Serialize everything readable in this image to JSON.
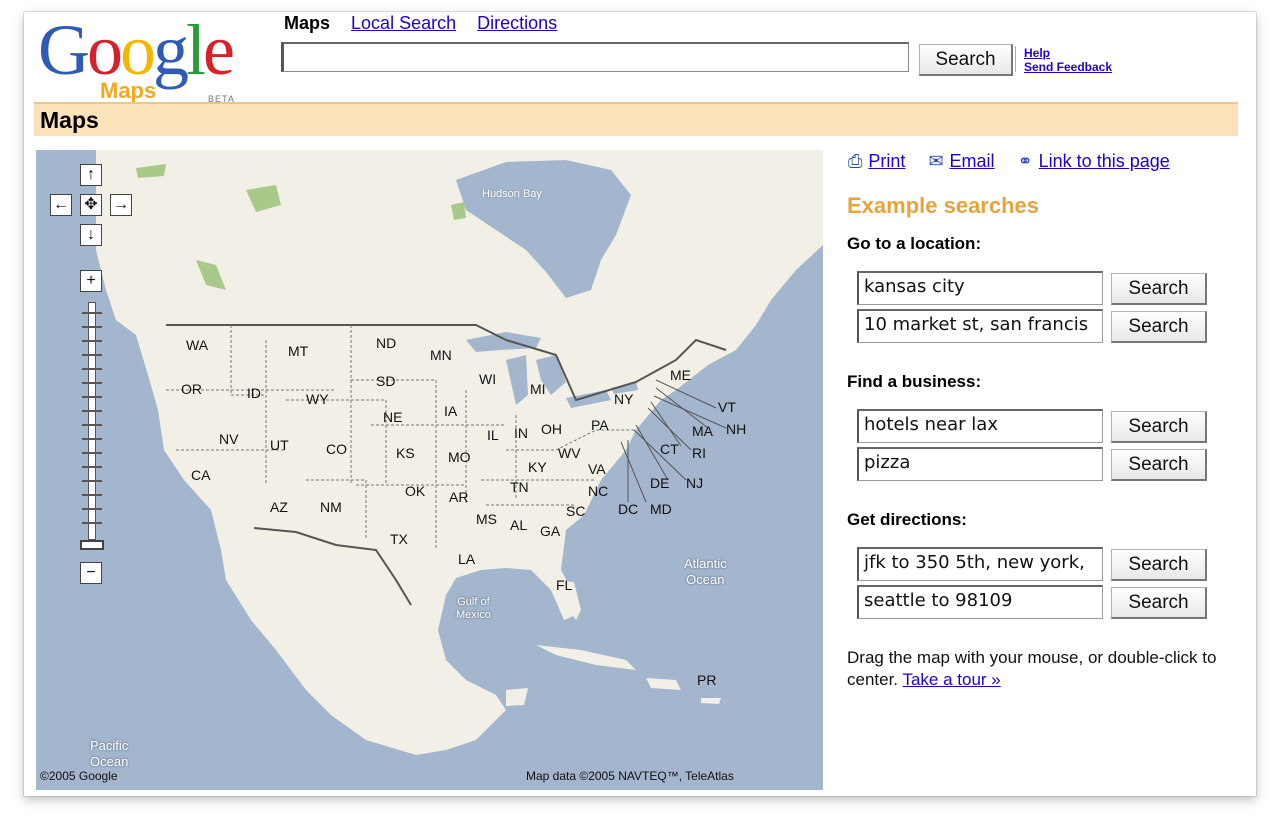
{
  "header": {
    "logo_text": "Google",
    "logo_sub": "Maps",
    "logo_beta": "BETA",
    "tabs": [
      {
        "label": "Maps",
        "current": true
      },
      {
        "label": "Local Search",
        "current": false
      },
      {
        "label": "Directions",
        "current": false
      }
    ],
    "search_value": "",
    "search_button": "Search",
    "help_link": "Help",
    "feedback_link": "Send Feedback"
  },
  "bar": {
    "title": "Maps"
  },
  "map": {
    "states": [
      "WA",
      "MT",
      "ND",
      "MN",
      "OR",
      "ID",
      "WY",
      "SD",
      "WI",
      "MI",
      "NY",
      "ME",
      "NE",
      "IA",
      "VT",
      "NV",
      "UT",
      "CO",
      "KS",
      "IL",
      "IN",
      "OH",
      "PA",
      "MA",
      "NH",
      "CT",
      "RI",
      "MO",
      "KY",
      "WV",
      "VA",
      "CA",
      "DE",
      "NJ",
      "OK",
      "AR",
      "TN",
      "NC",
      "AZ",
      "NM",
      "MS",
      "AL",
      "SC",
      "DC",
      "MD",
      "GA",
      "TX",
      "LA",
      "FL",
      "PR"
    ],
    "hudson_bay": "Hudson Bay",
    "atlantic": [
      "Atlantic",
      "Ocean"
    ],
    "gulf": [
      "Gulf of",
      "Mexico"
    ],
    "pacific": [
      "Pacific",
      "Ocean"
    ],
    "copyright_left": "©2005 Google",
    "copyright_right": "Map data ©2005 NAVTEQ™, TeleAtlas",
    "controls": {
      "up": "↑",
      "down": "↓",
      "left": "←",
      "right": "→",
      "center": "✥",
      "zoom_in": "+",
      "zoom_out": "−"
    }
  },
  "panel": {
    "links": [
      {
        "icon": "print-icon",
        "glyph": "⎙",
        "label": "Print"
      },
      {
        "icon": "email-icon",
        "glyph": "✉",
        "label": "Email"
      },
      {
        "icon": "link-icon",
        "glyph": "⚭",
        "label": "Link to this page"
      }
    ],
    "example_title": "Example searches",
    "sections": [
      {
        "title": "Go to a location:",
        "queries": [
          "kansas city",
          "10 market st, san francis"
        ]
      },
      {
        "title": "Find a business:",
        "queries": [
          "hotels near lax",
          "pizza"
        ]
      },
      {
        "title": "Get directions:",
        "queries": [
          "jfk to 350 5th, new york,",
          "seattle to 98109"
        ]
      }
    ],
    "search_label": "Search",
    "help_text": "Drag the map with your mouse, or double-click to center.",
    "tour_link": "Take a tour »"
  }
}
